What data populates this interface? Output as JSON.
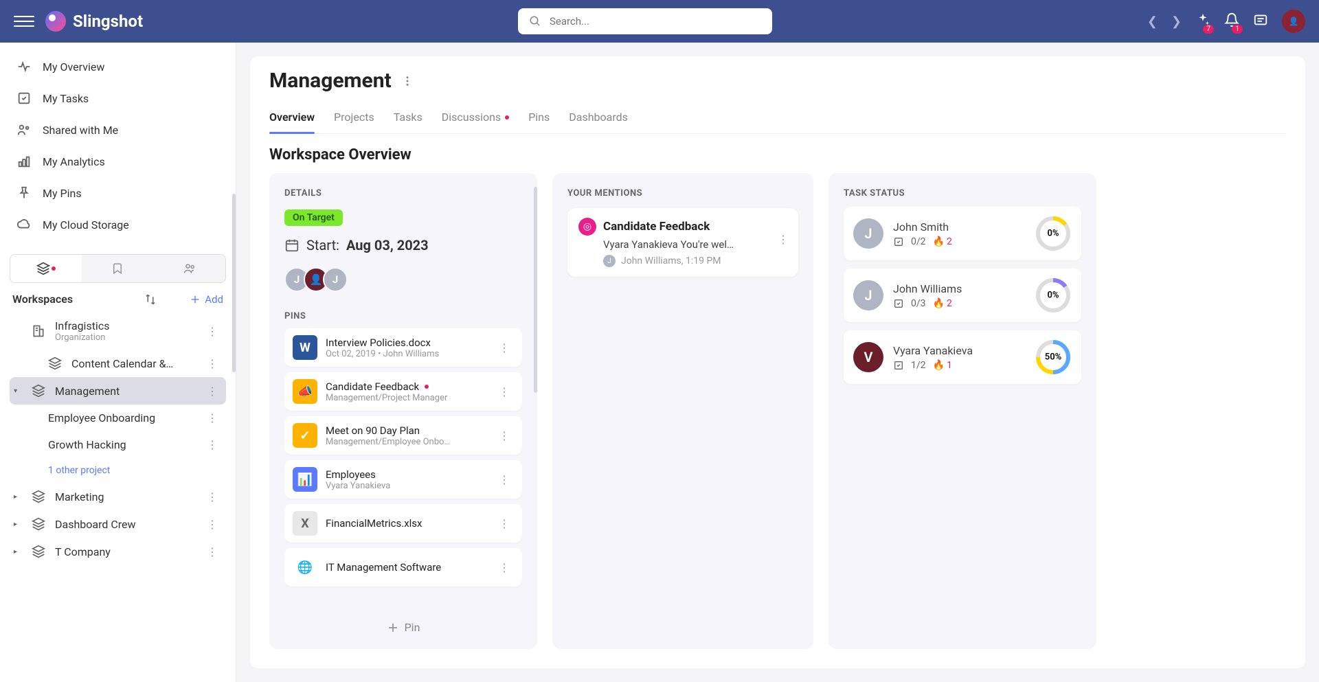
{
  "header": {
    "brand": "Slingshot",
    "search_placeholder": "Search...",
    "ai_badge": "7",
    "notif_badge": "1"
  },
  "sidebar": {
    "nav": [
      {
        "label": "My Overview"
      },
      {
        "label": "My Tasks"
      },
      {
        "label": "Shared with Me"
      },
      {
        "label": "My Analytics"
      },
      {
        "label": "My Pins"
      },
      {
        "label": "My Cloud Storage"
      }
    ],
    "ws_title": "Workspaces",
    "add_label": "Add",
    "items": [
      {
        "label": "Infragistics",
        "sub": "Organization",
        "dot": true
      },
      {
        "label": "Content Calendar &…",
        "dot": true
      },
      {
        "label": "Management",
        "active": true,
        "expanded": true
      },
      {
        "label": "Employee Onboarding",
        "child": true
      },
      {
        "label": "Growth Hacking",
        "child": true
      },
      {
        "label": "Marketing"
      },
      {
        "label": "Dashboard Crew"
      },
      {
        "label": "T Company"
      }
    ],
    "other_project": "1 other project"
  },
  "main": {
    "title": "Management",
    "tabs": [
      "Overview",
      "Projects",
      "Tasks",
      "Discussions",
      "Pins",
      "Dashboards"
    ],
    "section_title": "Workspace Overview",
    "details": {
      "label": "DETAILS",
      "status": "On Target",
      "start_prefix": "Start: ",
      "start_date": "Aug 03, 2023",
      "pins_label": "PINS",
      "pin_btn": "Pin",
      "pins": [
        {
          "title": "Interview Policies.docx",
          "sub": "Oct 02, 2019  •  John Williams",
          "icon": "W",
          "color": "#2b579a"
        },
        {
          "title": "Candidate Feedback",
          "sub": "Management/Project Manager",
          "icon": "📣",
          "color": "#ffb300",
          "dot": true
        },
        {
          "title": "Meet on 90 Day Plan",
          "sub": "Management/Employee Onbo…",
          "icon": "✓",
          "color": "#ffb300"
        },
        {
          "title": "Employees",
          "sub": "Vyara Yanakieva",
          "icon": "📊",
          "color": "#5b7aff"
        },
        {
          "title": "FinancialMetrics.xlsx",
          "sub": "",
          "icon": "X",
          "color": "#e8e8e8"
        },
        {
          "title": "IT Management Software",
          "sub": "",
          "icon": "🌐",
          "color": "#fff"
        }
      ]
    },
    "mentions": {
      "label": "YOUR MENTIONS",
      "items": [
        {
          "title": "Candidate Feedback",
          "body": "Vyara Yanakieva You're wel…",
          "meta_name": "John Williams",
          "meta_time": "1:19 PM",
          "initial": "J"
        }
      ]
    },
    "tasks": {
      "label": "TASK STATUS",
      "items": [
        {
          "name": "John Smith",
          "done": "0/2",
          "fire": "2",
          "pct": "0%",
          "pct_val": 0,
          "ring": "#ffd600",
          "initial": "J",
          "bg": "#b0b5c3"
        },
        {
          "name": "John Williams",
          "done": "0/3",
          "fire": "2",
          "pct": "0%",
          "pct_val": 0,
          "ring": "#8b7aff",
          "initial": "J",
          "bg": "#b0b5c3"
        },
        {
          "name": "Vyara Yanakieva",
          "done": "1/2",
          "fire": "1",
          "pct": "50%",
          "pct_val": 50,
          "ring": "#5ba8ff",
          "ring2": "#ffd600",
          "initial": "V",
          "bg": "#6b1f2a"
        }
      ]
    }
  }
}
